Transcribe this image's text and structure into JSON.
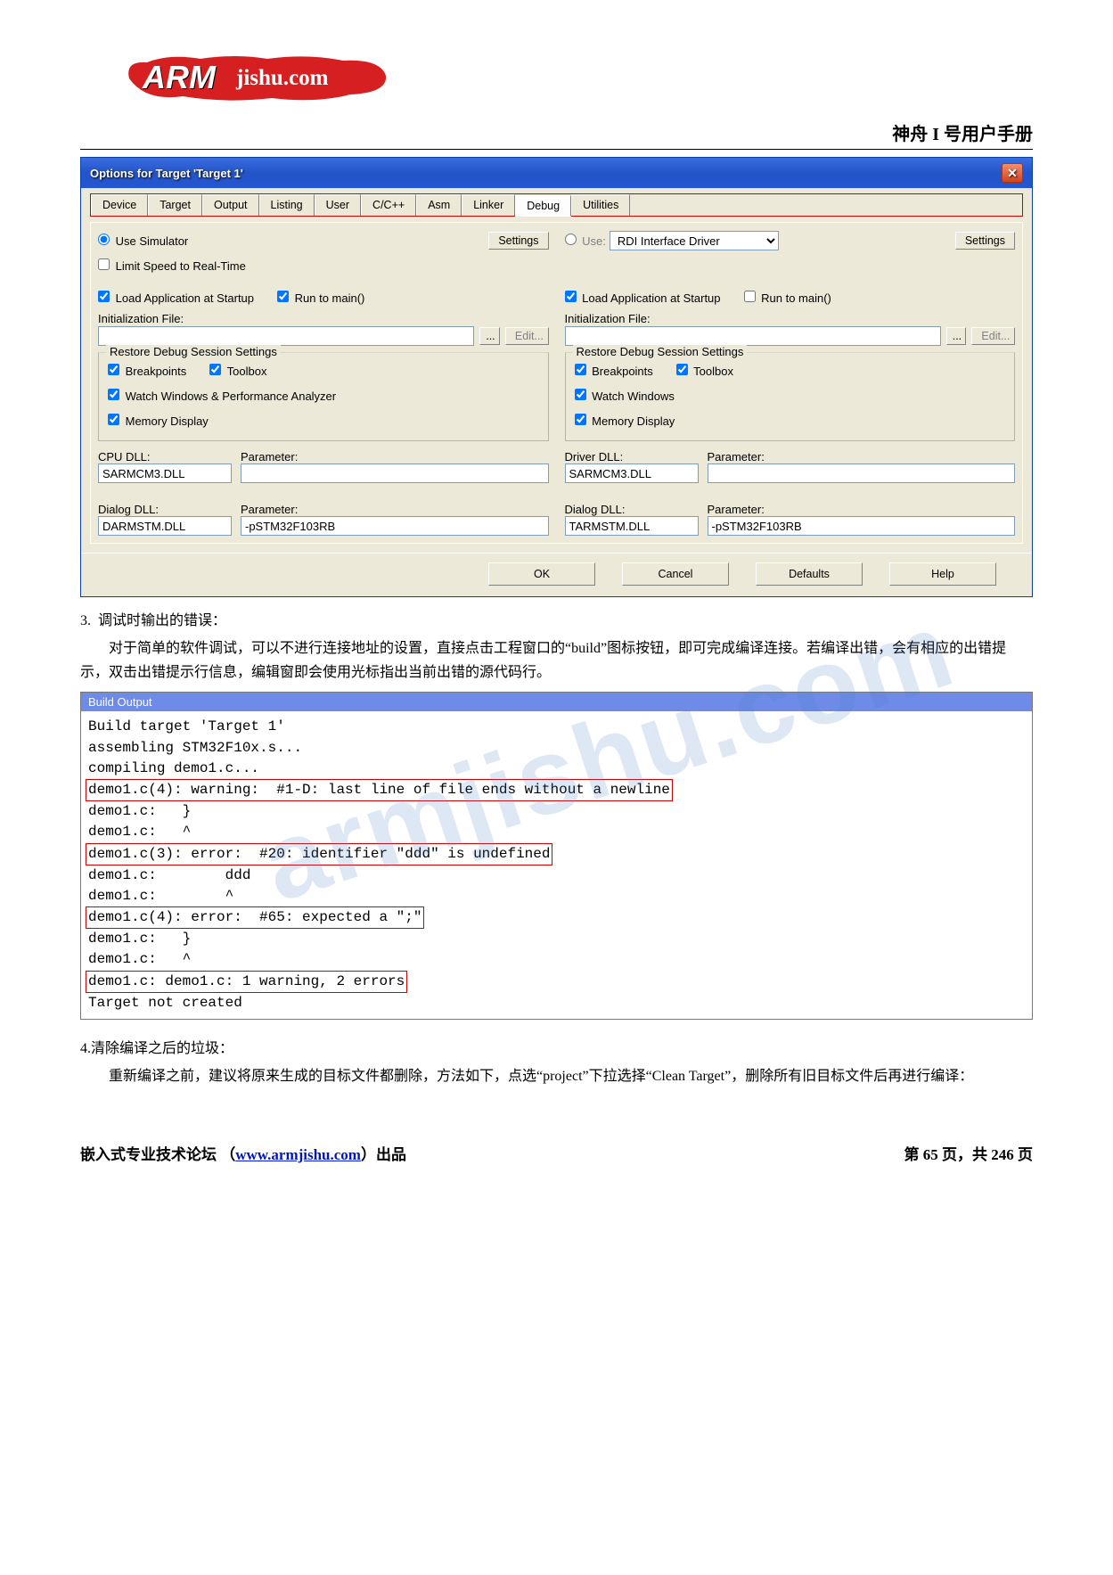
{
  "logo": {
    "arm": "ARM",
    "jishu": "jishu.com"
  },
  "doc_title": "神舟 I 号用户手册",
  "dialog": {
    "title": "Options for Target 'Target 1'",
    "tabs": [
      "Device",
      "Target",
      "Output",
      "Listing",
      "User",
      "C/C++",
      "Asm",
      "Linker",
      "Debug",
      "Utilities"
    ],
    "active_tab": "Debug",
    "left": {
      "use_sim": "Use Simulator",
      "limit_speed": "Limit Speed to Real-Time",
      "settings": "Settings",
      "load_app": "Load Application at Startup",
      "run_main": "Run to main()",
      "init_label": "Initialization File:",
      "browse": "...",
      "edit": "Edit...",
      "restore_legend": "Restore Debug Session Settings",
      "bp": "Breakpoints",
      "toolbox": "Toolbox",
      "watch": "Watch Windows & Performance Analyzer",
      "mem": "Memory Display",
      "cpu_dll_label": "CPU DLL:",
      "cpu_dll": "SARMCM3.DLL",
      "param_label": "Parameter:",
      "cpu_param": "",
      "dialog_dll_label": "Dialog DLL:",
      "dialog_dll": "DARMSTM.DLL",
      "dialog_param": "-pSTM32F103RB"
    },
    "right": {
      "use": "Use:",
      "driver_selected": "RDI Interface Driver",
      "settings": "Settings",
      "load_app": "Load Application at Startup",
      "run_main": "Run to main()",
      "init_label": "Initialization File:",
      "browse": "...",
      "edit": "Edit...",
      "restore_legend": "Restore Debug Session Settings",
      "bp": "Breakpoints",
      "toolbox": "Toolbox",
      "watch": "Watch Windows",
      "mem": "Memory Display",
      "driver_dll_label": "Driver DLL:",
      "driver_dll": "SARMCM3.DLL",
      "param_label": "Parameter:",
      "driver_param": "",
      "dialog_dll_label": "Dialog DLL:",
      "dialog_dll": "TARMSTM.DLL",
      "dialog_param": "-pSTM32F103RB"
    },
    "buttons": {
      "ok": "OK",
      "cancel": "Cancel",
      "defaults": "Defaults",
      "help": "Help"
    }
  },
  "section3": {
    "num": "3.",
    "title": "调试时输出的错误：",
    "body": "对于简单的软件调试，可以不进行连接地址的设置，直接点击工程窗口的“build”图标按钮，即可完成编译连接。若编译出错，会有相应的出错提示，双击出错提示行信息，编辑窗即会使用光标指出当前出错的源代码行。"
  },
  "build": {
    "title": "Build Output",
    "lines": {
      "l1": "Build target 'Target 1'",
      "l2": "assembling STM32F10x.s...",
      "l3": "compiling demo1.c...",
      "l4": "demo1.c(4): warning:  #1-D: last line of file ends without a newline",
      "l5": "demo1.c:   }",
      "l6": "demo1.c:   ^",
      "l7": "demo1.c(3): error:  #20: identifier \"ddd\" is undefined",
      "l8": "demo1.c:        ddd",
      "l9": "demo1.c:        ^",
      "l10": "demo1.c(4): error:  #65: expected a \";\"",
      "l11": "demo1.c:   }",
      "l12": "demo1.c:   ^",
      "l13": "demo1.c: demo1.c: 1 warning, 2 errors",
      "l14": "Target not created"
    }
  },
  "section4": {
    "title": "4.清除编译之后的垃圾：",
    "body": "重新编译之前，建议将原来生成的目标文件都删除，方法如下，点选“project”下拉选择“Clean Target”，删除所有旧目标文件后再进行编译："
  },
  "footer": {
    "left_a": "嵌入式专业技术论坛 （",
    "link": "www.armjishu.com",
    "left_b": "）出品",
    "right": "第 65 页，共 246 页"
  },
  "watermark": "armjishu.com"
}
